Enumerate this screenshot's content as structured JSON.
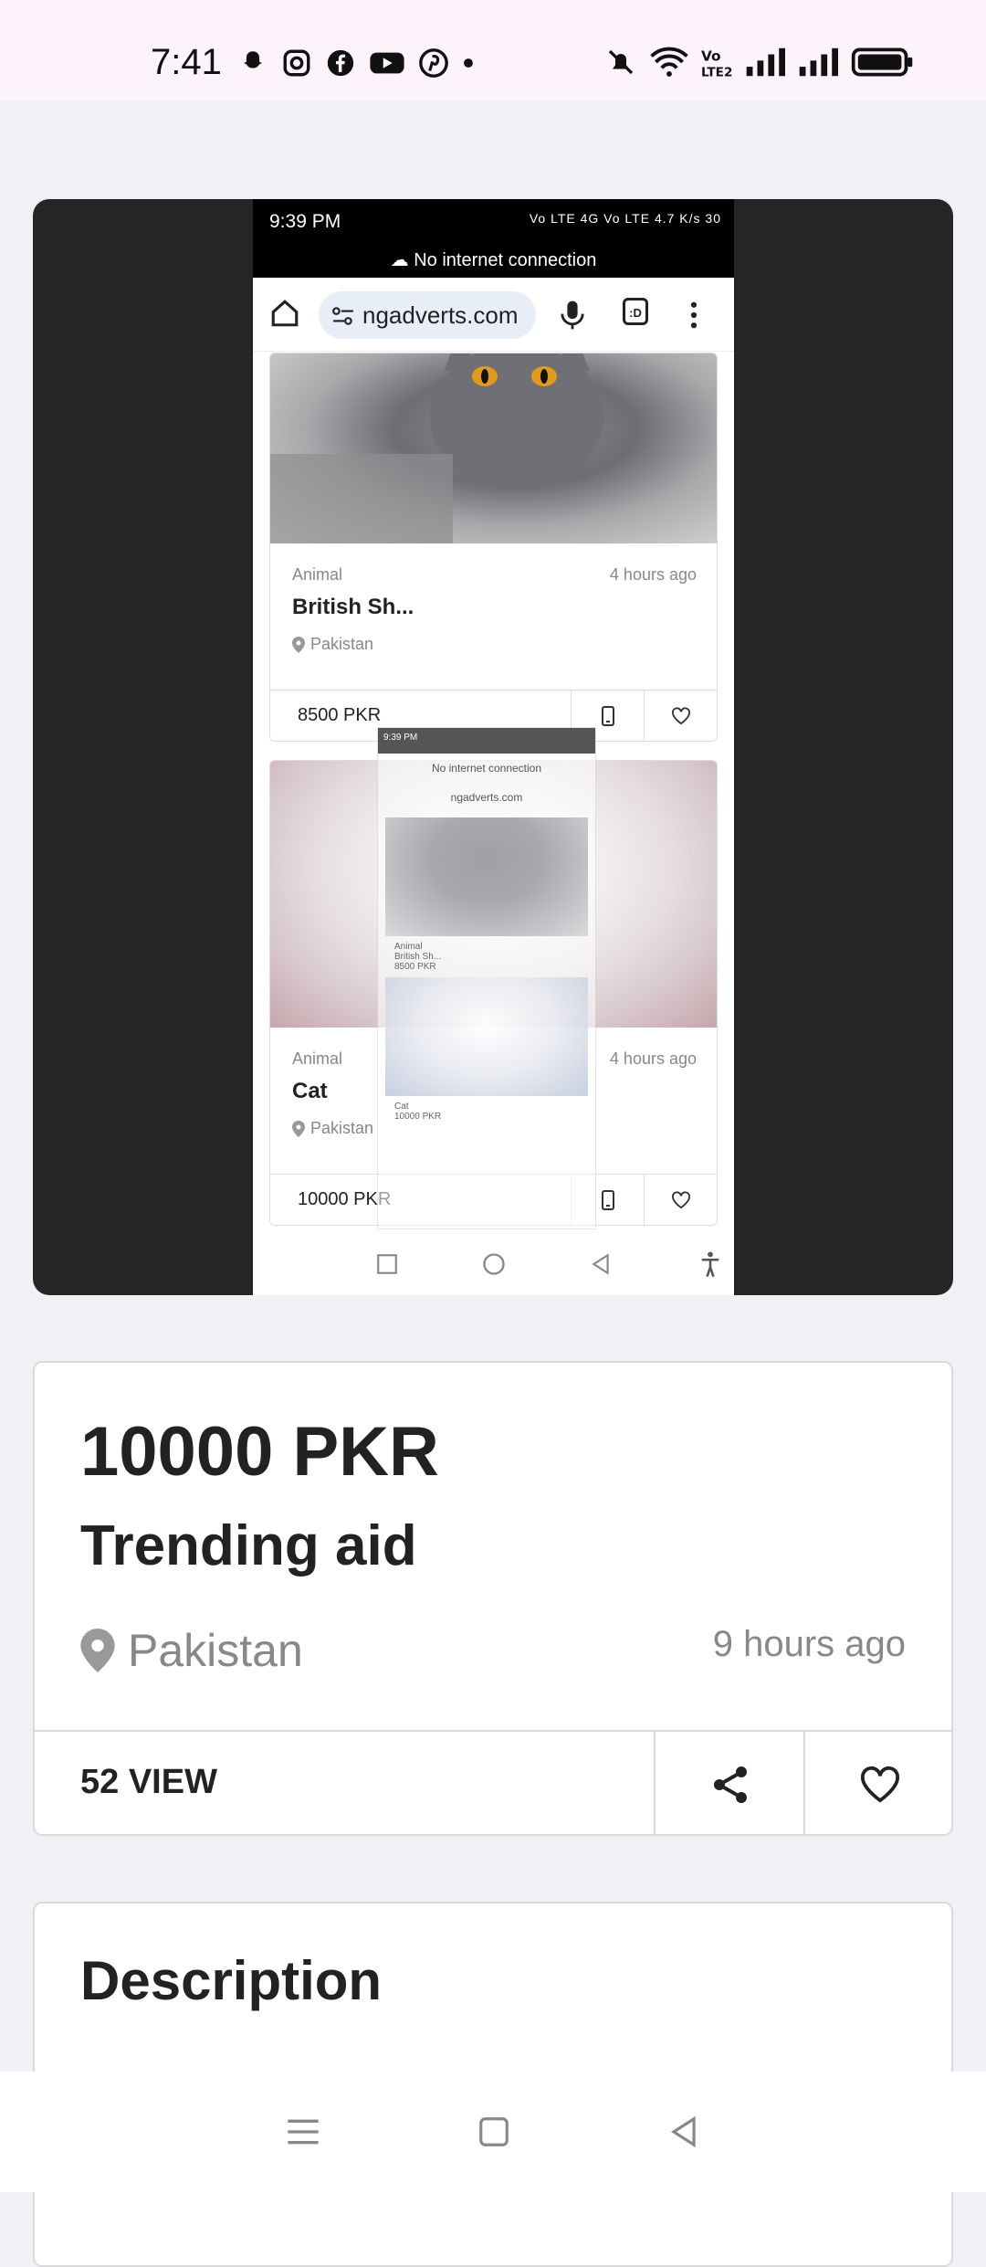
{
  "status_bar": {
    "time": "7:41"
  },
  "screenshot": {
    "status": {
      "time": "9:39 PM",
      "indicators": "Vo LTE 4G Vo LTE 4.7 K/s 30"
    },
    "banner": "No internet connection",
    "browser": {
      "url": "ngadverts.com",
      "tabs_count": ":D"
    },
    "ads": [
      {
        "category": "Animal",
        "time": "4 hours ago",
        "title": "British Sh...",
        "location": "Pakistan",
        "price": "8500 PKR"
      },
      {
        "category": "Animal",
        "time": "4 hours ago",
        "title": "Cat",
        "location": "Pakistan",
        "price": "10000 PKR"
      }
    ],
    "mini": {
      "status": "9:39 PM",
      "banner": "No internet connection",
      "url": "ngadverts.com",
      "ad1_cat": "Animal",
      "ad1_title": "British Sh...",
      "ad1_price": "8500 PKR",
      "ad2_title": "Cat",
      "ad2_price": "10000 PKR"
    }
  },
  "listing": {
    "price": "10000 PKR",
    "title": "Trending aid",
    "location": "Pakistan",
    "time_ago": "9 hours ago",
    "views": "52 VIEW"
  },
  "description": {
    "title": "Description"
  },
  "colors": {
    "background": "#f0f1f4",
    "status_bar": "#fdf3fa",
    "card_border": "#d9d9d9",
    "muted": "#888888"
  }
}
